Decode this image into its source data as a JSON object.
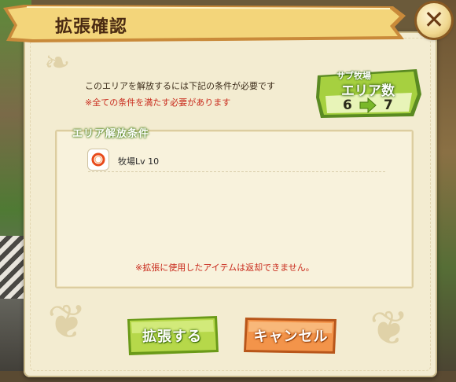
{
  "dialog": {
    "title": "拡張確認",
    "close_icon": "close-x-icon",
    "message": "このエリアを解放するには下記の条件が必要です",
    "note": "※全ての条件を満たす必要があります"
  },
  "area_sign": {
    "subtitle": "サブ牧場",
    "title": "エリア数",
    "from": "6",
    "to": "7",
    "arrow_icon": "right-arrow-icon"
  },
  "conditions": {
    "title": "エリア解放条件",
    "items": [
      {
        "icon": "ranch-level-ring-icon",
        "label": "牧場Lv 10"
      }
    ],
    "warning": "※拡張に使用したアイテムは返却できません。"
  },
  "buttons": {
    "expand": "拡張する",
    "cancel": "キャンセル"
  },
  "colors": {
    "parchment": "#f3ecd1",
    "banner": "#f0d27a",
    "title_text": "#4a2a12",
    "note_red": "#c8281a",
    "expand_green": "#a8cc3a",
    "cancel_orange": "#f0843a"
  }
}
